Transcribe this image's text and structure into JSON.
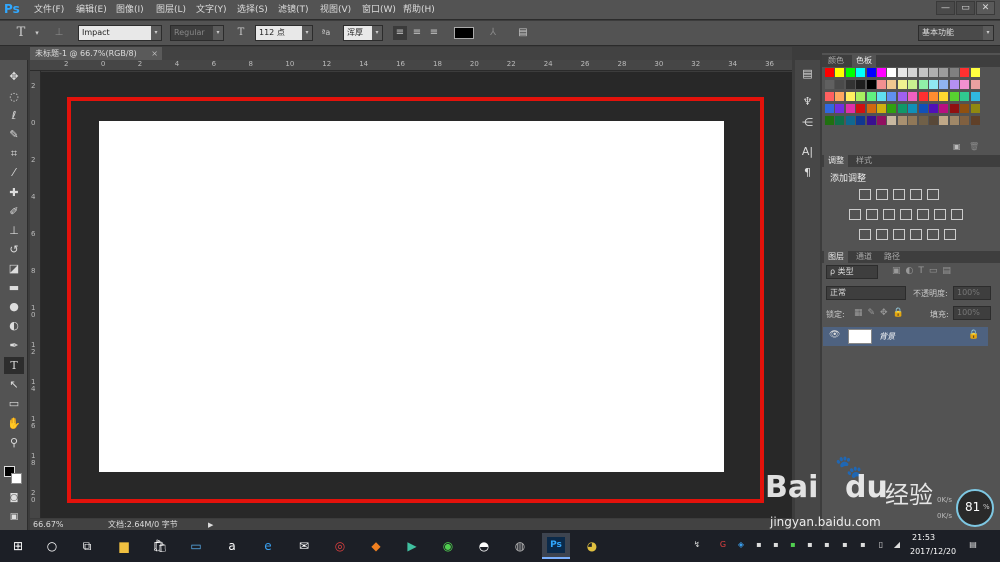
{
  "app": {
    "logo": "Ps"
  },
  "menu": [
    "文件(F)",
    "编辑(E)",
    "图像(I)",
    "图层(L)",
    "文字(Y)",
    "选择(S)",
    "滤镜(T)",
    "视图(V)",
    "窗口(W)",
    "帮助(H)"
  ],
  "window_controls": {
    "minimize": "—",
    "restore": "▭",
    "close": "✕"
  },
  "options": {
    "font_family": "Impact",
    "font_style": "Regular",
    "font_size": "112 点",
    "aa_label": "ªa",
    "aa_mode": "浑厚",
    "workspace": "基本功能",
    "text_color": "#000000"
  },
  "document": {
    "tab_title": "未标题-1 @ 66.7%(RGB/8)",
    "tab_close": "×"
  },
  "ruler": {
    "top": [
      "2",
      "0",
      "2",
      "4",
      "6",
      "8",
      "10",
      "12",
      "14",
      "16",
      "18",
      "20",
      "22",
      "24",
      "26",
      "28",
      "30",
      "32",
      "34",
      "36"
    ],
    "left": [
      "2",
      "0",
      "2",
      "4",
      "6",
      "8",
      "1 0",
      "1 2",
      "1 4",
      "1 6",
      "1 8",
      "2 0",
      "2 2"
    ]
  },
  "status": {
    "zoom": "66.67%",
    "doc_info": "文档:2.64M/0 字节"
  },
  "panels": {
    "swatch_tabs": [
      "颜色",
      "色板"
    ],
    "adjust_tabs": [
      "调整",
      "样式"
    ],
    "adjust_title": "添加调整",
    "layer_tabs": [
      "图层",
      "通道",
      "路径"
    ],
    "layer_kind": "ρ 类型",
    "blend_mode": "正常",
    "opacity_label": "不透明度:",
    "opacity_value": "100%",
    "lock_label": "锁定:",
    "fill_label": "填充:",
    "fill_value": "100%",
    "layer_name": "背景"
  },
  "swatch_colors": [
    [
      "#ff0000",
      "#ffff00",
      "#00ff00",
      "#00ffff",
      "#0000ff",
      "#ff00ff",
      "#ffffff",
      "#e6e6e6",
      "#d4d4d4",
      "#c4c4c4",
      "#b0b0b0",
      "#9c9c9c",
      "#808080",
      "#ff3030",
      "#ffff40"
    ],
    [
      "#606060",
      "#4a4a4a",
      "#333333",
      "#1e1e1e",
      "#000000",
      "#f09090",
      "#f0c890",
      "#f0f090",
      "#c8f090",
      "#90f0a8",
      "#90e8f0",
      "#90b4f0",
      "#b490f0",
      "#f090d0",
      "#e8a0a0"
    ],
    [
      "#ff6060",
      "#ffa860",
      "#fff060",
      "#a8f060",
      "#60f080",
      "#60e0f0",
      "#6090f0",
      "#a060f0",
      "#f060c0",
      "#ff3030",
      "#ff8c30",
      "#ffd830",
      "#58d030",
      "#30c890",
      "#30b8e0"
    ],
    [
      "#3068e0",
      "#7030e0",
      "#e030a8",
      "#d01010",
      "#d06810",
      "#d0b010",
      "#30a010",
      "#109868",
      "#1090b8",
      "#1050b8",
      "#5010b8",
      "#b81080",
      "#901010",
      "#905010",
      "#908810"
    ],
    [
      "#207010",
      "#107048",
      "#106890",
      "#103890",
      "#381090",
      "#901060",
      "#c8b8a0",
      "#a89070",
      "#907858",
      "#706048",
      "#584838",
      "#c0a888",
      "#a08868",
      "#806040",
      "#604028"
    ]
  ],
  "taskbar": {
    "time": "21:53",
    "date": "2017/12/20"
  },
  "watermark": {
    "brand": "Bai",
    "brand2": "du",
    "cn": "经验",
    "url": "jingyan.baidu.com"
  },
  "net_meter": {
    "value": "81",
    "unit": "%",
    "up": "0K/s",
    "down": "0K/s"
  },
  "colors": {
    "accent_blue": "#31a8ff",
    "frame_red": "#e3120b",
    "canvas_bg": "#282828"
  }
}
